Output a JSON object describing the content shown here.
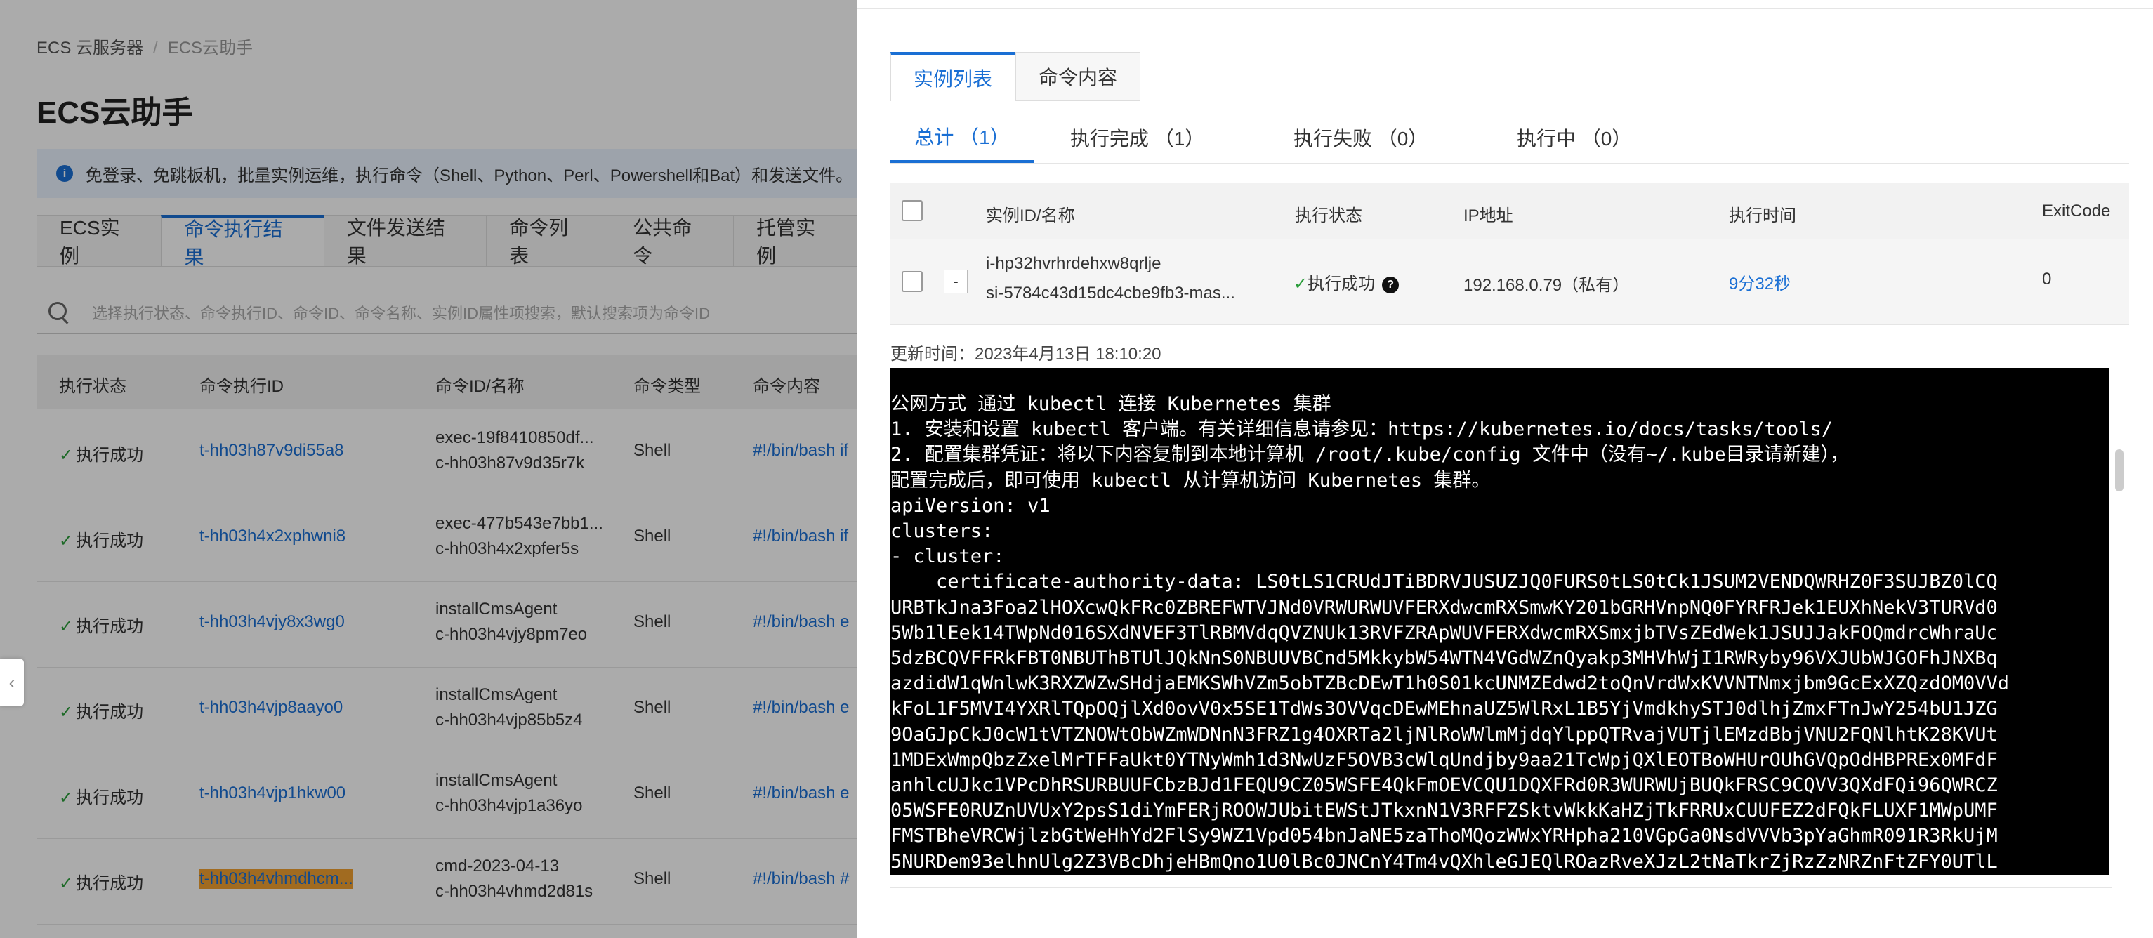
{
  "left": {
    "breadcrumb": {
      "root": "ECS 云服务器",
      "current": "ECS云助手"
    },
    "title": "ECS云助手",
    "notice": "免登录、免跳板机，批量实例运维，执行命令（Shell、Python、Perl、Powershell和Bat）和发送文件。",
    "tabs": [
      "ECS实例",
      "命令执行结果",
      "文件发送结果",
      "命令列表",
      "公共命令",
      "托管实例"
    ],
    "active_tab": "命令执行结果",
    "search_placeholder": "选择执行状态、命令执行ID、命令ID、命令名称、实例ID属性项搜索，默认搜索项为命令ID",
    "table": {
      "headers": [
        "执行状态",
        "命令执行ID",
        "命令ID/名称",
        "命令类型",
        "命令内容"
      ],
      "rows": [
        {
          "status": "执行成功",
          "exec_id": "t-hh03h87v9di55a8",
          "cmd1": "exec-19f8410850df...",
          "cmd2": "c-hh03h87v9d35r7k",
          "type": "Shell",
          "content": "#!/bin/bash if"
        },
        {
          "status": "执行成功",
          "exec_id": "t-hh03h4x2xphwni8",
          "cmd1": "exec-477b543e7bb1...",
          "cmd2": "c-hh03h4x2xpfer5s",
          "type": "Shell",
          "content": "#!/bin/bash if"
        },
        {
          "status": "执行成功",
          "exec_id": "t-hh03h4vjy8x3wg0",
          "cmd1": "installCmsAgent",
          "cmd2": "c-hh03h4vjy8pm7eo",
          "type": "Shell",
          "content": "#!/bin/bash e"
        },
        {
          "status": "执行成功",
          "exec_id": "t-hh03h4vjp8aayo0",
          "cmd1": "installCmsAgent",
          "cmd2": "c-hh03h4vjp85b5z4",
          "type": "Shell",
          "content": "#!/bin/bash e"
        },
        {
          "status": "执行成功",
          "exec_id": "t-hh03h4vjp1hkw00",
          "cmd1": "installCmsAgent",
          "cmd2": "c-hh03h4vjp1a36yo",
          "type": "Shell",
          "content": "#!/bin/bash e"
        },
        {
          "status": "执行成功",
          "exec_id": "t-hh03h4vhmdhcm...",
          "cmd1": "cmd-2023-04-13",
          "cmd2": "c-hh03h4vhmd2d81s",
          "type": "Shell",
          "content": "#!/bin/bash #"
        }
      ]
    },
    "drawer_handle": "‹"
  },
  "panel": {
    "tabs": [
      "实例列表",
      "命令内容"
    ],
    "active_tab": "实例列表",
    "status_tabs": [
      "总计 （1）",
      "执行完成 （1）",
      "执行失败 （0）",
      "执行中 （0）"
    ],
    "table": {
      "headers": [
        "实例ID/名称",
        "执行状态",
        "IP地址",
        "执行时间",
        "ExitCode"
      ],
      "row": {
        "instance_id": "i-hp32hvrhrdehxw8qrlje",
        "instance_name": "si-5784c43d15dc4cbe9fb3-mas...",
        "collapse": "-",
        "status": "执行成功",
        "ip": "192.168.0.79（私有）",
        "time": "9分32秒",
        "exit_code": "0"
      }
    },
    "updated": "更新时间：2023年4月13日 18:10:20",
    "output_lines": [
      "公网方式 通过 kubectl 连接 Kubernetes 集群",
      "1. 安装和设置 kubectl 客户端。有关详细信息请参见：https://kubernetes.io/docs/tasks/tools/",
      "2. 配置集群凭证：将以下内容复制到本地计算机 /root/.kube/config 文件中（没有~/.kube目录请新建），",
      "配置完成后，即可使用 kubectl 从计算机访问 Kubernetes 集群。",
      "apiVersion: v1",
      "clusters:",
      "- cluster:",
      "    certificate-authority-data: LS0tLS1CRUdJTiBDRVJUSUZJQ0FURS0tLS0tCk1JSUM2VENDQWRHZ0F3SUJBZ0lCQ",
      "URBTkJna3Foa2lHOXcwQkFRc0ZBREFWTVJNd0VRWURWUVFERXdwcmRXSmwKY201bGRHVnpNQ0FYRFRJek1EUXhNekV3TURVd0",
      "5Wb1lEek14TWpNd016SXdNVEF3TlRBMVdqQVZNUk13RVFZRApWUVFERXdwcmRXSmxjbTVsZEdWek1JSUJJakFOQmdrcWhraUc",
      "5dzBCQVFFRkFBT0NBUThBTUlJQkNnS0NBUUVBCnd5MkkybW54WTN4VGdWZnQyakp3MHVhWjI1RWRyby96VXJUbWJGOFhJNXBq",
      "azdidW1qWnlwK3RXZWZwSHdjaEMKSWhVZm5obTZBcDEwT1h0S01kcUNMZEdwd2toQnVrdWxKVVNTNmxjbm9GcExXZQzdOM0VVd",
      "kFoL1F5MVI4YXRlTQpOQjlXd0ovV0x5SE1TdWs3OVVqcDEwMEhnaUZ5WlRxL1B5YjVmdkhySTJ0dlhjZmxFTnJwY254bU1JZG",
      "9OaGJpCkJ0cW1tVTZNOWtObWZmWDNnN3FRZ1g4OXRTa2ljNlRoWWlmMjdqYlppQTRvajVUTjlEMzdBbjVNU2FQNlhtK28KVUt",
      "1MDExWmpQbzZxelMrTFFaUkt0YTNyWmh1d3NwUzF5OVB3cWlqUndjby9aa21TcWpjQXlEOTBoWHUrOUhGVQpOdHBPREx0MFdF",
      "anhlcUJkc1VPcDhRSURBUUFCbzBJd1FEQU9CZ05WSFE4QkFmOEVCQU1DQXFRd0R3WURWUjBUQkFRSC9CQVV3QXdFQi96QWRCZ",
      "05WSFE0RUZnUVUxY2psS1diYmFERjROOWJUbitEWStJTkxnN1V3RFFZSktvWkkKaHZjTkFRRUxCUUFEZ2dFQkFLUXF1MWpUMF",
      "FMSTBheVRCWjlzbGtWeHhYd2FlSy9WZ1Vpd054bnJaNE5zaThoMQozWWxYRHpha210VGpGa0NsdVVVb3pYaGhmR091R3RkUjM",
      "5NURDem93elhnUlg2Z3VBcDhjeHBmQno1U0lBc0JNCnY4Tm4vQXhleGJEQlROazRveXJzL2tNaTkrZjRzZzNRZnFtZFY0UTlL"
    ]
  }
}
